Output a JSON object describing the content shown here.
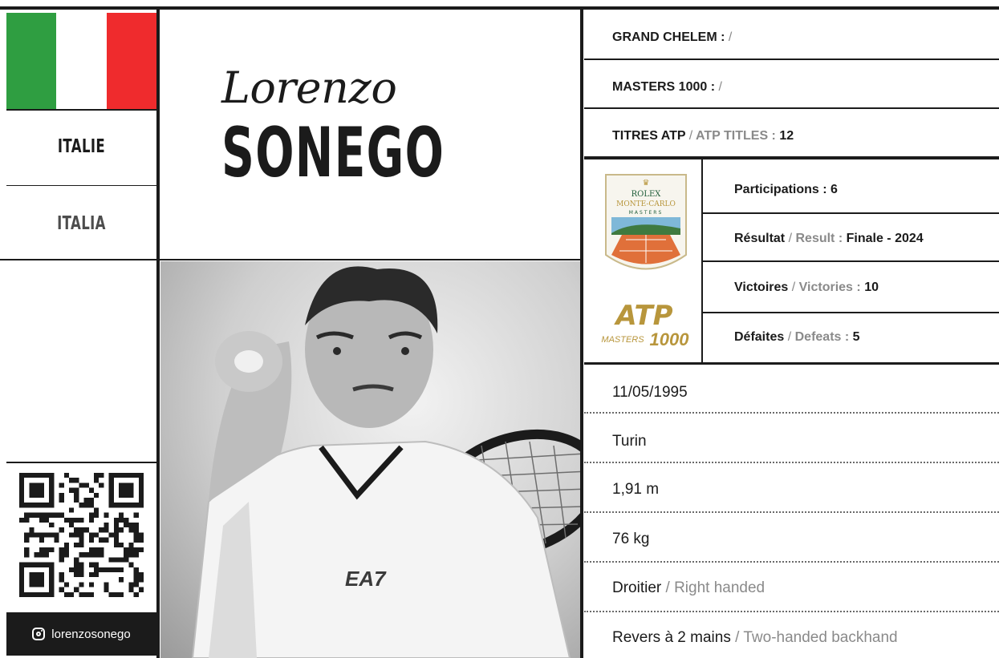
{
  "player": {
    "first_name": "Lorenzo",
    "last_name": "SONEGO",
    "country_fr": "ITALIE",
    "country_local": "ITALIA",
    "instagram": "lorenzosonego"
  },
  "career": {
    "grand_chelem_label": "GRAND CHELEM :",
    "grand_chelem_value": "/",
    "masters_label": "MASTERS 1000 :",
    "masters_value": "/",
    "titles_label_fr": "TITRES ATP",
    "titles_sep": "/",
    "titles_label_en": "ATP TITLES :",
    "titles_value": "12"
  },
  "tournament": {
    "logo_line1": "ROLEX",
    "logo_line2": "MONTE-CARLO",
    "logo_line3": "MASTERS",
    "atp_logo_text": "ATP",
    "atp_sub_a": "MASTERS",
    "atp_sub_b": "1000",
    "participations_label": "Participations :",
    "participations_value": "6",
    "result_label_fr": "Résultat",
    "result_sep": "/",
    "result_label_en": "Result :",
    "result_value": "Finale - 2024",
    "wins_label_fr": "Victoires",
    "wins_sep": "/",
    "wins_label_en": "Victories :",
    "wins_value": "10",
    "losses_label_fr": "Défaites",
    "losses_sep": "/",
    "losses_label_en": "Defeats :",
    "losses_value": "5"
  },
  "bio": {
    "birthdate": "11/05/1995",
    "birthplace": "Turin",
    "height": "1,91 m",
    "weight": "76 kg",
    "hand_fr": "Droitier",
    "hand_sep": "/",
    "hand_en": "Right handed",
    "backhand_fr": "Revers à 2 mains",
    "backhand_sep": "/",
    "backhand_en": "Two-handed backhand"
  },
  "shirt_brand": "EA7",
  "colors": {
    "flag_green": "#2f9e41",
    "flag_white": "#ffffff",
    "flag_red": "#ef2b2d",
    "ink": "#1b1b1b",
    "muted": "#8a8a8a",
    "atp_gold": "#b8963c"
  }
}
